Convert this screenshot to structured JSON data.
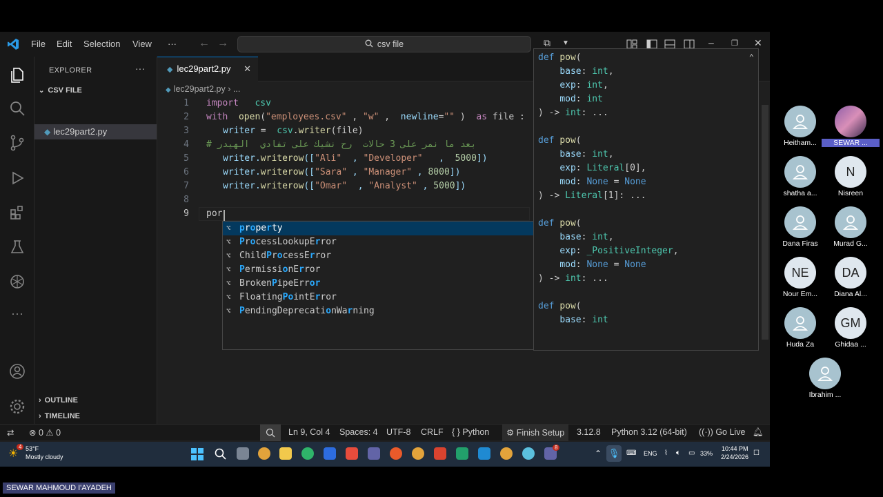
{
  "titlebar": {
    "menu": [
      "File",
      "Edit",
      "Selection",
      "View",
      "···"
    ],
    "search": "csv file"
  },
  "explorer": {
    "title": "EXPLORER",
    "more": "···",
    "folder": "CSV FILE",
    "file": "lec29part2.py",
    "outline": "OUTLINE",
    "timeline": "TIMELINE"
  },
  "editor": {
    "tab_label": "lec29part2.py",
    "tab_close": "✕",
    "breadcrumb_file": "lec29part2.py",
    "breadcrumb_rest": "› ...",
    "line_numbers": [
      "1",
      "2",
      "3",
      "4",
      "5",
      "6",
      "7",
      "8",
      "9"
    ],
    "lines": [
      {
        "kw": "import",
        "rest": "   csv"
      },
      {
        "kw": "with",
        "a": "  ",
        "fn": "open",
        "b": "(",
        "s1": "\"employees.csv\"",
        "c": " , ",
        "s2": "\"w\"",
        "d": " ,  ",
        "v": "newline",
        "e": "=",
        "s3": "\"\"",
        "f": " )  ",
        "kw2": "as",
        "g": " file :"
      },
      {
        "v": "writer",
        "a": " =  ",
        "v2": "csv",
        "b": ".",
        "fn": "writer",
        "c": "(file)"
      },
      {
        "comment": "# بعد ما نمر على 3 حالات  رح نشيك على تفادي  الهيدر"
      },
      {
        "row": "writer.writerow([\"Ali\"  , \"Developer\"   ,  5000])"
      },
      {
        "row": "writer.writerow([\"Sara\" , \"Manager\" , 8000])"
      },
      {
        "row": "writer.writerow([\"Omar\"  , \"Analyst\" , 5000])"
      },
      {
        "row": ""
      },
      {
        "row": "por"
      }
    ]
  },
  "suggestions": [
    "property",
    "ProcessLookupError",
    "ChildProcessError",
    "PermissionError",
    "BrokenPipeError",
    "FloatingPointError",
    "PendingDeprecationWarning"
  ],
  "hover": [
    "def pow(",
    "    base: int,",
    "    exp: int,",
    "    mod: int",
    ") -> int: ...",
    "",
    "def pow(",
    "    base: int,",
    "    exp: Literal[0],",
    "    mod: None = None",
    ") -> Literal[1]: ...",
    "",
    "def pow(",
    "    base: int,",
    "    exp: _PositiveInteger,",
    "    mod: None = None",
    ") -> int: ...",
    "",
    "def pow(",
    "    base: int"
  ],
  "statusbar": {
    "errors": "0",
    "warnings": "0",
    "position": "Ln 9, Col 4",
    "spaces": "Spaces: 4",
    "encoding": "UTF-8",
    "eol": "CRLF",
    "language": "Python",
    "finish_setup": "Finish Setup",
    "py_version": "3.12.8",
    "interpreter": "Python 3.12 (64-bit)",
    "golive": "Go Live"
  },
  "taskbar": {
    "weather_temp": "53°F",
    "weather_desc": "Mostly cloudy",
    "weather_badge": "4",
    "lang": "ENG",
    "battery": "33%",
    "time": "10:44 PM",
    "date": "2/24/2026",
    "teams_badge": "8"
  },
  "participants": [
    {
      "name": "Heitham...",
      "initials": ""
    },
    {
      "name": "SEWAR ...",
      "initials": ""
    },
    {
      "name": "shatha a...",
      "initials": ""
    },
    {
      "name": "Nisreen",
      "initials": "N"
    },
    {
      "name": "Dana Firas",
      "initials": ""
    },
    {
      "name": "Murad G...",
      "initials": ""
    },
    {
      "name": "Nour Em...",
      "initials": "NE"
    },
    {
      "name": "Diana Al...",
      "initials": "DA"
    },
    {
      "name": "Huda Za",
      "initials": ""
    },
    {
      "name": "Ghidaa ...",
      "initials": "GM"
    },
    {
      "name": "Ibrahim ...",
      "initials": ""
    }
  ],
  "presenter_name": "SEWAR MAHMOUD I'AYADEH",
  "colors": {
    "accent": "#0078d4",
    "selection": "#04395e",
    "editor_bg": "#1f1f1f",
    "teams_purple": "#5b5fc7"
  }
}
